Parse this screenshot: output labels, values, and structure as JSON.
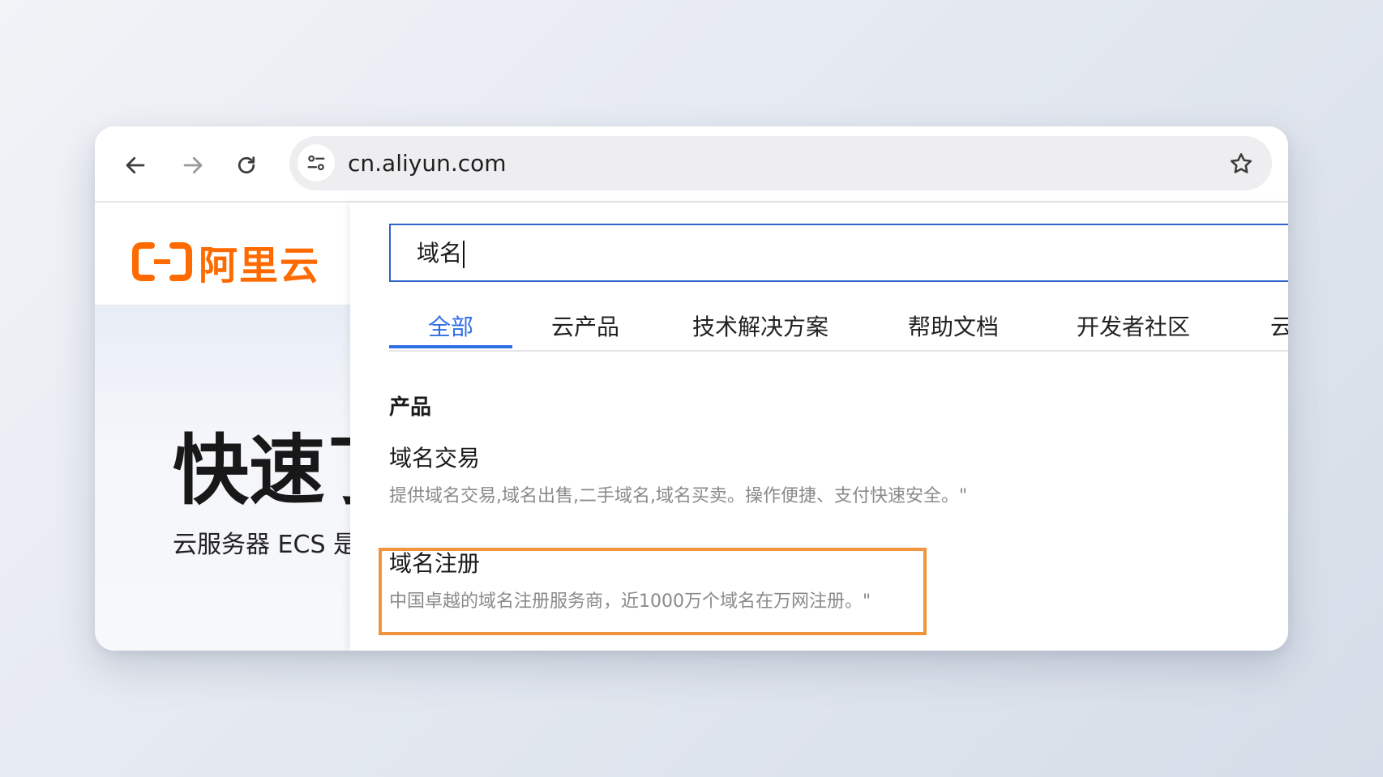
{
  "browser": {
    "url": "cn.aliyun.com",
    "icons": {
      "back": "arrow-left-icon",
      "forward": "arrow-right-icon",
      "reload": "reload-icon",
      "site_info": "tune-icon",
      "bookmark": "star-icon"
    }
  },
  "site": {
    "logo_text": "阿里云",
    "brand_color": "#ff6a00",
    "hero_title": "快速了",
    "hero_subtitle": "云服务器 ECS 是"
  },
  "search": {
    "query": "域名",
    "tabs": [
      {
        "label": "全部",
        "active": true
      },
      {
        "label": "云产品",
        "active": false
      },
      {
        "label": "技术解决方案",
        "active": false
      },
      {
        "label": "帮助文档",
        "active": false
      },
      {
        "label": "开发者社区",
        "active": false
      },
      {
        "label": "云",
        "active": false
      }
    ],
    "section_title": "产品",
    "results": [
      {
        "title": "域名交易",
        "description": "提供域名交易,域名出售,二手域名,域名买卖。操作便捷、支付快速安全。\""
      },
      {
        "title": "域名注册",
        "description": "中国卓越的域名注册服务商，近1000万个域名在万网注册。\"",
        "highlighted": true
      }
    ],
    "accent_color": "#2f6fe4",
    "highlight_color": "#f0953e"
  }
}
